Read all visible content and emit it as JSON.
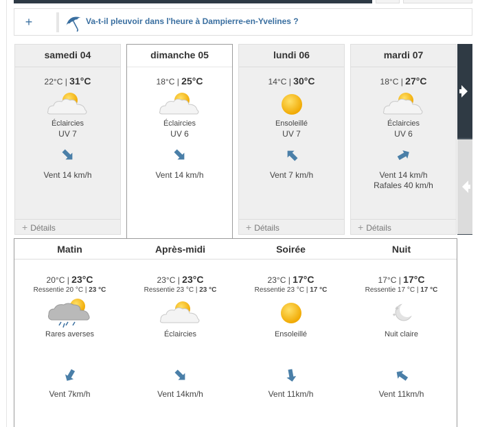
{
  "rain_banner": {
    "plus": "+",
    "icon": "umbrella-icon",
    "text": "Va-t-il pleuvoir dans l'heure à Dampierre-en-Yvelines ?"
  },
  "days": [
    {
      "name": "samedi 04",
      "tmin": "22°C",
      "sep": " | ",
      "tmax": "31°C",
      "icon": "partly-cloudy-icon",
      "desc": "Éclaircies",
      "uv": "UV 7",
      "wind_dir": "arrow-down-right-icon",
      "wind": "Vent 14 km/h",
      "gusts": "",
      "details": "Détails"
    },
    {
      "name": "dimanche 05",
      "tmin": "18°C",
      "sep": " | ",
      "tmax": "25°C",
      "icon": "partly-cloudy-icon",
      "desc": "Éclaircies",
      "uv": "UV 6",
      "wind_dir": "arrow-down-right-icon",
      "wind": "Vent 14 km/h",
      "gusts": "",
      "details": ""
    },
    {
      "name": "lundi 06",
      "tmin": "14°C",
      "sep": " | ",
      "tmax": "30°C",
      "icon": "sun-icon",
      "desc": "Ensoleillé",
      "uv": "UV 7",
      "wind_dir": "arrow-up-left-icon",
      "wind": "Vent 7 km/h",
      "gusts": "",
      "details": "Détails"
    },
    {
      "name": "mardi 07",
      "tmin": "18°C",
      "sep": " | ",
      "tmax": "27°C",
      "icon": "partly-cloudy-icon",
      "desc": "Éclaircies",
      "uv": "UV 6",
      "wind_dir": "arrow-up-right-icon",
      "wind": "Vent 14 km/h",
      "gusts": "Rafales 40 km/h",
      "details": "Détails"
    }
  ],
  "nav": {
    "next": "next-arrow-icon",
    "prev": "prev-arrow-icon"
  },
  "periods": [
    {
      "name": "Matin",
      "tmin": "20°C",
      "sep": " | ",
      "tmax": "23°C",
      "feel_label": "Ressentie 20 °C",
      "feel_sep": " | ",
      "feel_val": "23 °C",
      "icon": "showers-icon",
      "desc": "Rares averses",
      "wind_dir": "arrow-down-left-icon",
      "wind": "Vent 7km/h"
    },
    {
      "name": "Après-midi",
      "tmin": "23°C",
      "sep": " | ",
      "tmax": "23°C",
      "feel_label": "Ressentie 23 °C",
      "feel_sep": " | ",
      "feel_val": "23 °C",
      "icon": "partly-cloudy-icon",
      "desc": "Éclaircies",
      "wind_dir": "arrow-down-right-icon",
      "wind": "Vent 14km/h"
    },
    {
      "name": "Soirée",
      "tmin": "23°C",
      "sep": " | ",
      "tmax": "17°C",
      "feel_label": "Ressentie 23 °C",
      "feel_sep": " | ",
      "feel_val": "17 °C",
      "icon": "sun-icon",
      "desc": "Ensoleillé",
      "wind_dir": "arrow-down-icon",
      "wind": "Vent 11km/h"
    },
    {
      "name": "Nuit",
      "tmin": "17°C",
      "sep": " | ",
      "tmax": "17°C",
      "feel_label": "Ressentie 17 °C",
      "feel_sep": " | ",
      "feel_val": "17 °C",
      "icon": "clear-night-icon",
      "desc": "Nuit claire",
      "wind_dir": "arrow-up-left-icon",
      "wind": "Vent 11km/h"
    }
  ],
  "colors": {
    "accent": "#3a6fa0",
    "sun": "#f5b400",
    "arrow": "#4a7fa8",
    "dark": "#2e3a45"
  }
}
